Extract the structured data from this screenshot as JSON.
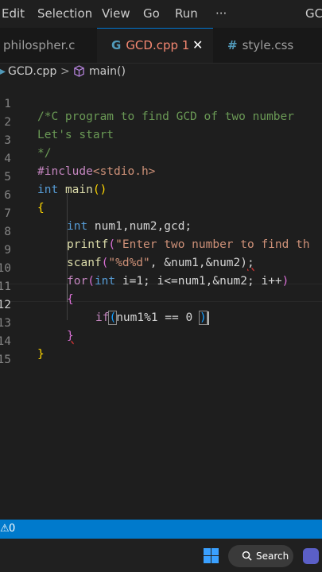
{
  "menubar": {
    "items": [
      "Edit",
      "Selection",
      "View",
      "Go",
      "Run",
      "···"
    ],
    "title_fragment": "GC"
  },
  "tabs": [
    {
      "label": "philospher.c",
      "icon": "",
      "active": false
    },
    {
      "label": "GCD.cpp 1",
      "icon": "G",
      "active": true,
      "close": "✕"
    },
    {
      "label": "style.css",
      "icon": "#",
      "active": false
    }
  ],
  "breadcrumb": {
    "file": "GCD.cpp",
    "separator": ">",
    "symbol": "main()"
  },
  "editor": {
    "line_numbers": [
      "1",
      "2",
      "3",
      "4",
      "5",
      "6",
      "7",
      "8",
      "9",
      "10",
      "11",
      "12",
      "13",
      "14",
      "15"
    ],
    "lines": {
      "l1": "/*C program to find GCD of two number",
      "l2": "Let's start",
      "l3": "*/",
      "l4_kw": "#include",
      "l4_hdr": "<stdio.h>",
      "l5_type": "int",
      "l5_fn": "main",
      "l5_paren": "()",
      "l6": "{",
      "l7_type": "int",
      "l7_rest": " num1,num2,gcd;",
      "l8_fn": "printf",
      "l8_paren": "(",
      "l8_str": "\"Enter two number to find th",
      "l9_fn": "scanf",
      "l9_paren": "(",
      "l9_str": "\"%d%d\"",
      "l9_rest": ", &num1,&num2)",
      "l9_semi": ";",
      "l10_kw": "for",
      "l10_paren": "(",
      "l10_type": "int",
      "l10_rest": " i=1; i<=num1,&num2; i++",
      "l10_close": ")",
      "l11": "{",
      "l12_kw": "if",
      "l12_paren": "(",
      "l12_rest": "num1%1 == 0 ",
      "l12_close": ")",
      "l13": "}",
      "l14": "}"
    }
  },
  "statusbar": {
    "problems_icon": "⚠",
    "problems_count": "0"
  },
  "taskbar": {
    "search_label": "Search",
    "search_icon": "search-icon"
  },
  "colors": {
    "accent": "#007acc",
    "background": "#1e1e1e",
    "tab_active_text": "#ff6b6b"
  }
}
